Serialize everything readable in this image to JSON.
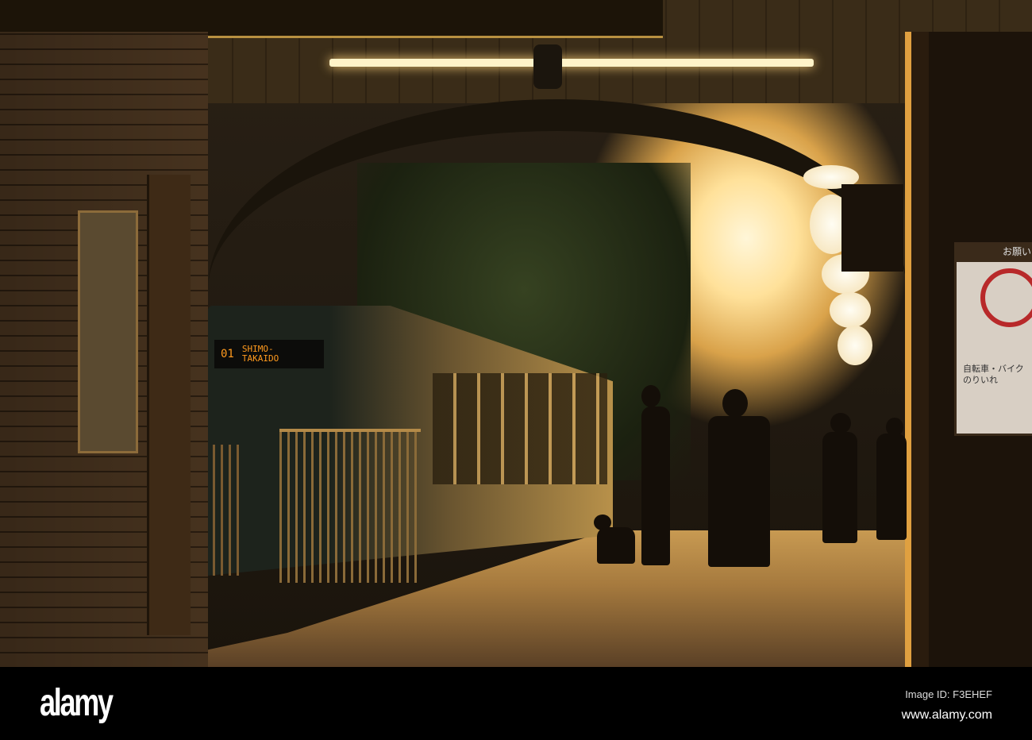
{
  "tram": {
    "route_number": "01",
    "destination_line1": "SHIMO-",
    "destination_line2": "TAKAIDO"
  },
  "sign": {
    "header": "お願い",
    "text": "自転車・バイクのりいれ"
  },
  "watermark": {
    "logo": "alamy",
    "image_id": "Image ID: F3EHEF",
    "website": "www.alamy.com"
  },
  "colors": {
    "sun": "#ffe19a",
    "destination_led": "#ff9a1e",
    "prohibition_red": "#b8292a"
  }
}
